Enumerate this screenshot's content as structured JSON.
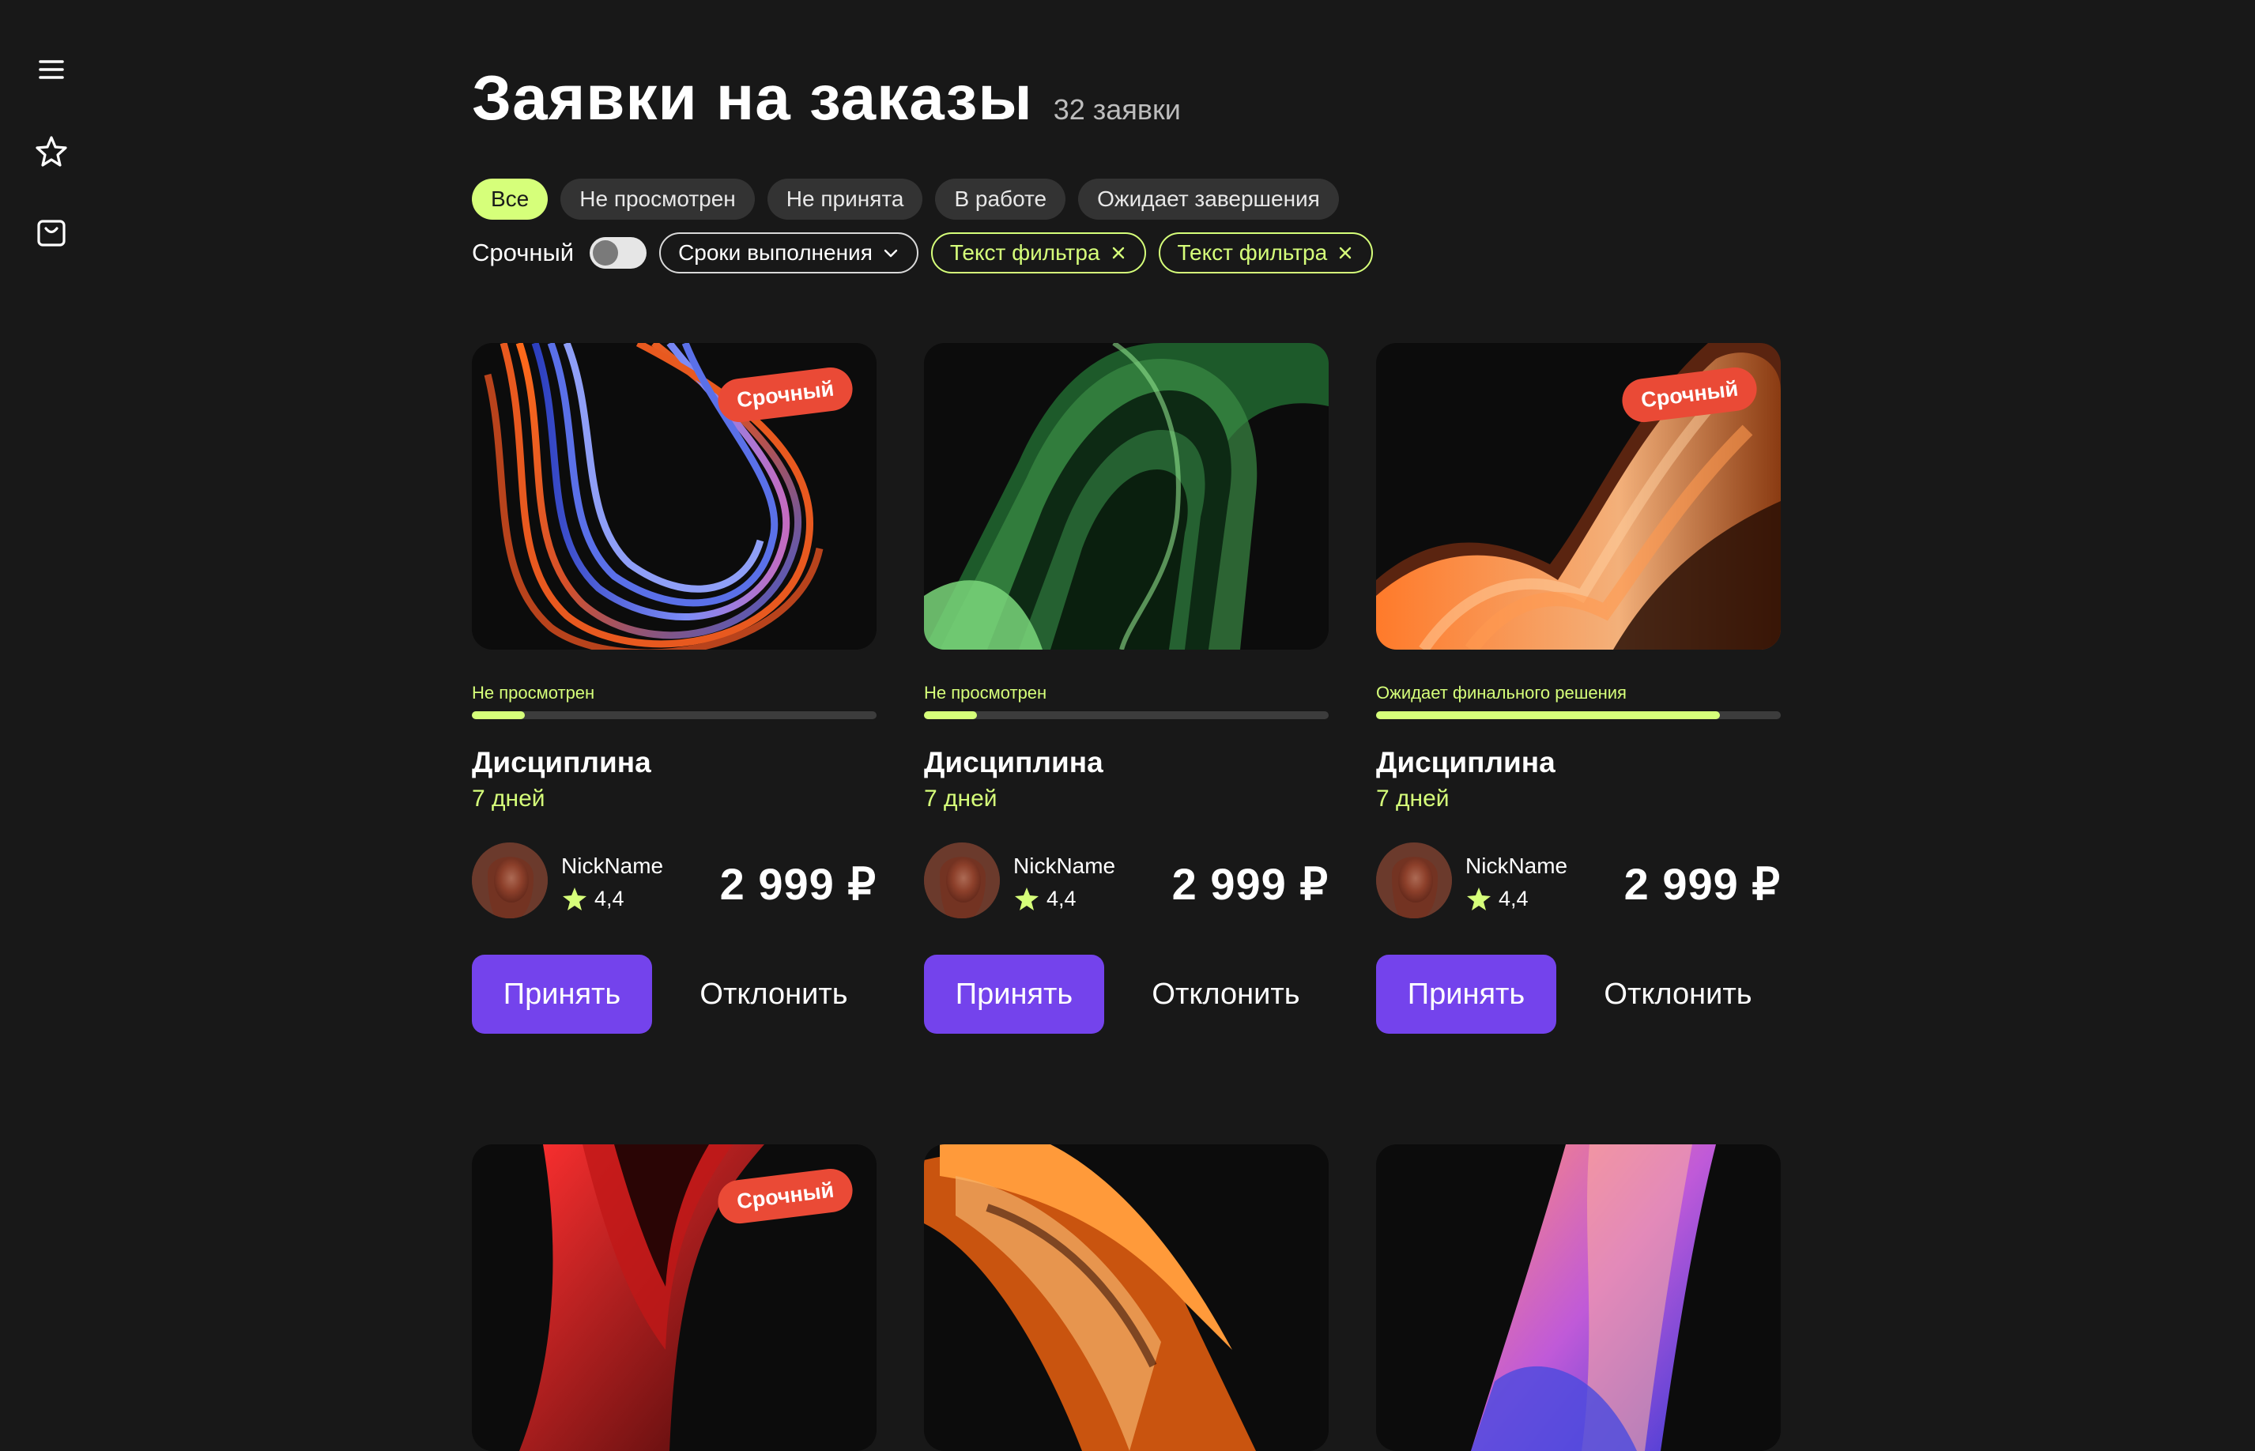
{
  "sidebar": {
    "icons": [
      "menu-icon",
      "star-icon",
      "bag-icon"
    ]
  },
  "header": {
    "title": "Заявки на заказы",
    "count": "32 заявки"
  },
  "filters": {
    "tabs": [
      {
        "label": "Все",
        "active": true
      },
      {
        "label": "Не просмотрен",
        "active": false
      },
      {
        "label": "Не принята",
        "active": false
      },
      {
        "label": "В работе",
        "active": false
      },
      {
        "label": "Ожидает завершения",
        "active": false
      }
    ],
    "urgent_label": "Срочный",
    "urgent_on": false,
    "deadline_label": "Сроки выполнения",
    "tag1": "Текст фильтра",
    "tag2": "Текст фильтра"
  },
  "cards": [
    {
      "badge": "Срочный",
      "status": "Не просмотрен",
      "progress": 0.13,
      "title": "Дисциплина",
      "days": "7 дней",
      "nick": "NickName",
      "rating": "4,4",
      "price": "2 999 ₽",
      "accept": "Принять",
      "decline": "Отклонить"
    },
    {
      "badge": "",
      "status": "Не просмотрен",
      "progress": 0.13,
      "title": "Дисциплина",
      "days": "7 дней",
      "nick": "NickName",
      "rating": "4,4",
      "price": "2 999 ₽",
      "accept": "Принять",
      "decline": "Отклонить"
    },
    {
      "badge": "Срочный",
      "status": "Ожидает финального решения",
      "progress": 0.85,
      "title": "Дисциплина",
      "days": "7 дней",
      "nick": "NickName",
      "rating": "4,4",
      "price": "2 999 ₽",
      "accept": "Принять",
      "decline": "Отклонить"
    },
    {
      "badge": "Срочный"
    },
    {
      "badge": ""
    },
    {
      "badge": ""
    }
  ],
  "colors": {
    "background": "#181818",
    "accent_green": "#d6ff7a",
    "accent_purple": "#7443ec",
    "badge_red": "#ea4a36"
  }
}
